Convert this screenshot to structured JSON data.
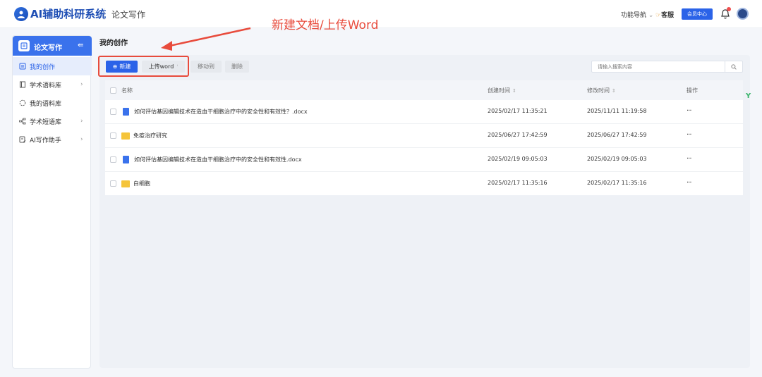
{
  "header": {
    "app_title": "AI辅助科研系统",
    "section_title": "论文写作",
    "nav_link": "功能导航",
    "service": "客服",
    "member_center": "会员中心"
  },
  "annotation": "新建文档/上传Word",
  "sidebar": {
    "title": "论文写作",
    "items": [
      {
        "label": "我的创作",
        "icon": "document-icon",
        "active": true
      },
      {
        "label": "学术语料库",
        "icon": "library-icon",
        "chevron": true
      },
      {
        "label": "我的语料库",
        "icon": "loading-circle-icon"
      },
      {
        "label": "学术短语库",
        "icon": "tree-icon",
        "chevron": true
      },
      {
        "label": "AI写作助手",
        "icon": "ai-document-icon",
        "chevron": true
      }
    ]
  },
  "main": {
    "page_title": "我的创作",
    "toolbar": {
      "new_label": "新建",
      "upload_label": "上传word",
      "move_label": "移动到",
      "delete_label": "删除"
    },
    "search": {
      "placeholder": "请输入搜索内容"
    },
    "table": {
      "headers": {
        "name": "名称",
        "created": "创建时间",
        "modified": "修改时间",
        "actions": "操作"
      },
      "rows": [
        {
          "type": "file",
          "name": "如何评估基因编辑技术在造血干细胞治疗中的安全性和有效性？.docx",
          "created": "2025/02/17 11:35:21",
          "modified": "2025/11/11 11:19:58",
          "actions": "···"
        },
        {
          "type": "folder",
          "name": "免疫治疗研究",
          "created": "2025/06/27 17:42:59",
          "modified": "2025/06/27 17:42:59",
          "actions": "···"
        },
        {
          "type": "file",
          "name": "如何评估基因编辑技术在造血干细胞治疗中的安全性和有效性.docx",
          "created": "2025/02/19 09:05:03",
          "modified": "2025/02/19 09:05:03",
          "actions": "···"
        },
        {
          "type": "folder",
          "name": "白细胞",
          "created": "2025/02/17 11:35:16",
          "modified": "2025/02/17 11:35:16",
          "actions": "···"
        }
      ]
    }
  },
  "colors": {
    "accent": "#2b63e8",
    "annotation": "#e84b3c",
    "folder": "#f5c43a"
  }
}
